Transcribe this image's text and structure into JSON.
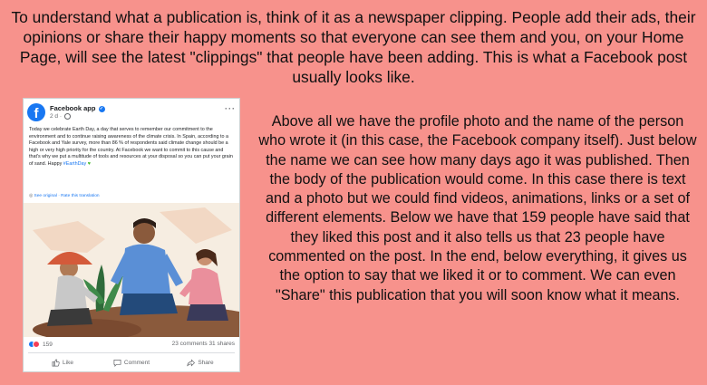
{
  "intro_text": "To understand what a publication is, think of it as a newspaper clipping. People add their ads, their opinions or share their happy moments so that everyone can see them and you, on your Home Page, will see the latest \"clippings\" that people have been adding. This is what a Facebook post usually looks like.",
  "explain_text": "Above all we have the profile photo and the name of the person who wrote it (in this case, the Facebook company itself). Just below the name we can see how many days ago it was published. Then the body of the publication would come. In this case there is text and a photo but we could find videos, animations, links or a set of different elements. Below we have that 159 people have said that they liked this post and it also tells us that 23 people have commented on the post. In the end, below everything, it gives us the option to say that we liked it or to comment. We can even \"Share\" this publication that you will soon know what it means.",
  "post": {
    "author": "Facebook app",
    "avatar_letter": "f",
    "time": "2 d ·",
    "menu": "···",
    "body": "Today we celebrate Earth Day, a day that serves to remember our commitment to the environment and to continue raising awareness of the climate crisis. In Spain, according to a Facebook and Yale survey, more than 86 % of respondents said climate change should be a high or very high priority for the country. At Facebook we want to commit to this cause and that's why we put a multitude of tools and resources at your disposal so you can put your grain of sand. Happy",
    "hashtag": "#EarthDay",
    "see_original": "See original",
    "rate_translation": "Rate this translation",
    "reactions_count": "159",
    "comments_shares": "23 comments  31 shares",
    "like_label": "Like",
    "comment_label": "Comment",
    "share_label": "Share"
  },
  "colors": {
    "background": "#f7928c",
    "facebook_blue": "#1877f2"
  },
  "icons": [
    "globe-icon",
    "verified-icon",
    "like-reaction-icon",
    "love-reaction-icon",
    "thumbs-up-icon",
    "comment-icon",
    "share-icon",
    "heart-icon"
  ]
}
